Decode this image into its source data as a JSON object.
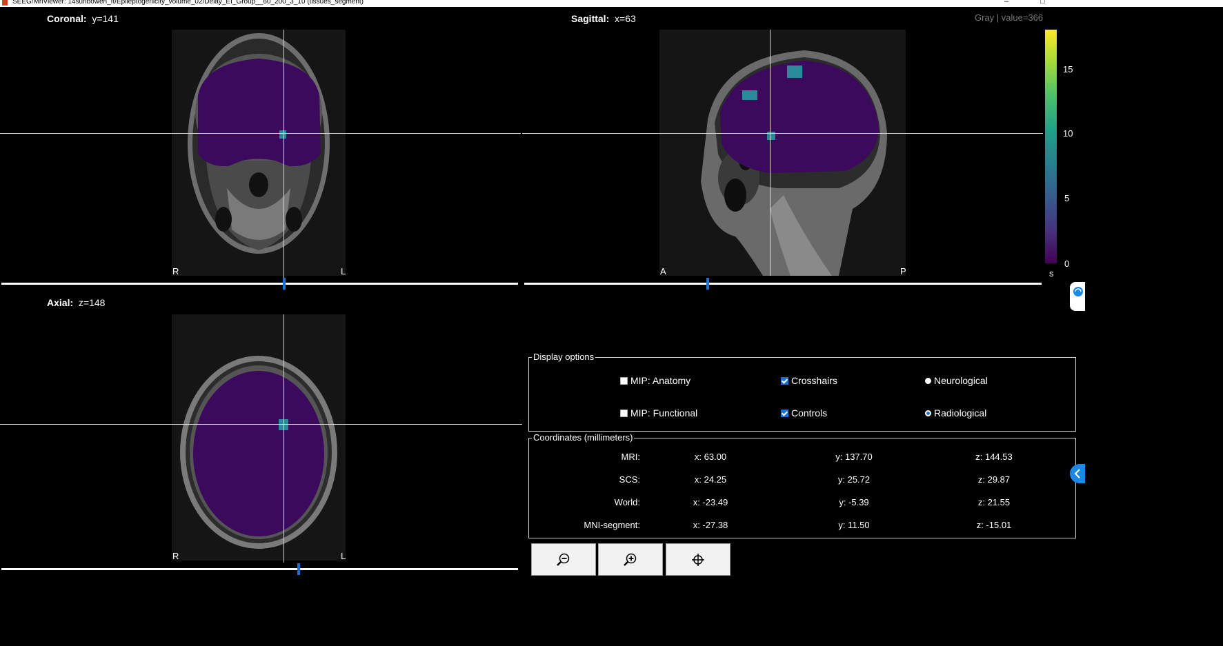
{
  "window": {
    "title": "SEEG/MriViewer: 14sunbowen_ft/Epileptogenicity_volume_02/Delay_EI_Group__60_200_3_10 (tissues_segment)"
  },
  "views": {
    "coronal": {
      "name": "Coronal:",
      "coord": "y=141",
      "orient_left": "R",
      "orient_right": "L"
    },
    "sagittal": {
      "name": "Sagittal:",
      "coord": "x=63",
      "orient_left": "A",
      "orient_right": "P"
    },
    "axial": {
      "name": "Axial:",
      "coord": "z=148",
      "orient_left": "R",
      "orient_right": "L"
    }
  },
  "slider_positions": {
    "coronal": 0.55,
    "sagittal": 0.35,
    "axial": 0.58
  },
  "colorbar": {
    "info": "Gray  |  value=366",
    "ticks": [
      "15",
      "10",
      "5",
      "0"
    ],
    "unit": "s",
    "colormap": [
      "#440154",
      "#365c8d",
      "#1fa187",
      "#a0da39",
      "#fde725"
    ]
  },
  "display_options": {
    "legend": "Display options",
    "mip_anatomy": {
      "label": "MIP: Anatomy",
      "checked": false
    },
    "mip_functional": {
      "label": "MIP: Functional",
      "checked": false
    },
    "crosshairs": {
      "label": "Crosshairs",
      "checked": true
    },
    "controls": {
      "label": "Controls",
      "checked": true
    },
    "neurological": {
      "label": "Neurological",
      "selected": false
    },
    "radiological": {
      "label": "Radiological",
      "selected": true
    }
  },
  "coordinates": {
    "legend": "Coordinates (millimeters)",
    "rows": [
      {
        "label": "MRI:",
        "x": "x: 63.00",
        "y": "y: 137.70",
        "z": "z: 144.53"
      },
      {
        "label": "SCS:",
        "x": "x: 24.25",
        "y": "y: 25.72",
        "z": "z: 29.87"
      },
      {
        "label": "World:",
        "x": "x: -23.49",
        "y": "y: -5.39",
        "z": "z: 21.55"
      },
      {
        "label": "MNI-segment:",
        "x": "x: -27.38",
        "y": "y: 11.50",
        "z": "z: -15.01"
      }
    ]
  },
  "toolbar": {
    "buttons": [
      {
        "icon": "zoom-out-icon"
      },
      {
        "icon": "zoom-in-icon"
      },
      {
        "icon": "crosshair-target-icon"
      }
    ]
  },
  "colors": {
    "overlay": "#3c0a5c",
    "hotspot": "#2a8a9a",
    "crosshair": "#dcdcdc",
    "slider_thumb": "#1e73d2"
  }
}
